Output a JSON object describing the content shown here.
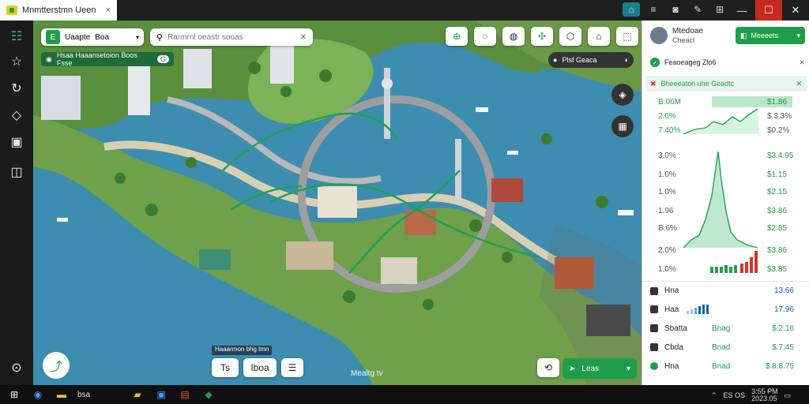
{
  "window": {
    "app_title": "Mnmtterstmn Ueen",
    "close_symbol": "×",
    "toolbar_icons": [
      "home-icon",
      "bars-icon",
      "camera-icon",
      "paint-icon",
      "sliders-icon"
    ],
    "minimize_symbol": "—",
    "maximize_symbol": "☐",
    "winclose_symbol": "✕"
  },
  "left_sidebar": {
    "items": [
      "layers-icon",
      "star-icon",
      "refresh-icon",
      "chat-icon",
      "gallery-icon",
      "book-icon"
    ],
    "bottom_icon": "settings-icon"
  },
  "map_toolbar": {
    "project_label": "Uaapte",
    "view_label": "Boa",
    "search_placeholder": "Rarmrnl oeastr sooas",
    "route_chip": "Hsaa Haaansetoion Boos Fsse",
    "route_chip_count": "G",
    "tool_icons": [
      "pin-icon",
      "chat-icon",
      "balloon-icon",
      "crossing-icon",
      "shield-icon",
      "bag-icon",
      "frame-icon"
    ],
    "top_right_chip": "Plsf Geaca",
    "top_right_chip_icon": "user-icon"
  },
  "map_bottom": {
    "caption": "Haaarmon bhg tmn",
    "tool_buttons": [
      "Ts",
      "Iboa",
      "☰"
    ],
    "watermark": "Mealtg tv",
    "go_label": "Leas"
  },
  "right_panel": {
    "user_name": "Mtedoae",
    "user_subtitle": "Cheacl",
    "action_button": "Meeeets",
    "notice_text": "Feaoeageg Zlo6",
    "error_text": "Bheeeaton uhe Geadtc",
    "chart_values_top": [
      {
        "left": "B.06M",
        "right": "$1.86"
      },
      {
        "left": "2.0%",
        "right": "$.3.3%"
      },
      {
        "left": "7.40%",
        "right": "$0.2%"
      }
    ],
    "chart_values_mid": [
      {
        "left": "3.0%",
        "right": "$3.4.95"
      },
      {
        "left": "1.0%",
        "right": "$1.15"
      },
      {
        "left": "1.0%",
        "right": "$2.15"
      },
      {
        "left": "1.96",
        "right": "$3.86"
      },
      {
        "left": "B.6%",
        "right": "$2.85"
      },
      {
        "left": "2.0%",
        "right": "$3.86"
      },
      {
        "left": "1.0%",
        "right": "$3.85"
      }
    ],
    "list": [
      {
        "label": "Hna",
        "value": "13.66"
      },
      {
        "label": "Haa",
        "value": "17.96"
      },
      {
        "label": "Sbatta",
        "value": "$.2.16"
      },
      {
        "label": "Cbda",
        "value": "$.7.45"
      },
      {
        "label": "Hna",
        "value": "$.8.8.75"
      }
    ],
    "list_middle": [
      "Bnag",
      "Bnad",
      "Bnad"
    ],
    "colors": {
      "accent": "#1e9e4a",
      "error": "#d9342b",
      "chart_line": "#22a052",
      "bar_blue": "#1560b8"
    }
  },
  "taskbar": {
    "search_hint": "bsa",
    "tray_text": "ES OS",
    "time": "3:55 PM",
    "date": "2023.05"
  }
}
